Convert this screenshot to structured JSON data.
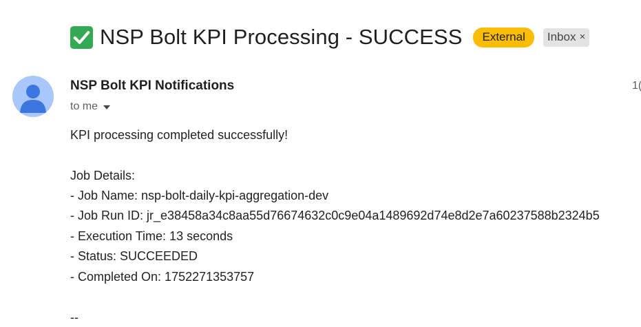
{
  "subject": {
    "icon": "check-mark-icon",
    "title": "NSP Bolt KPI Processing - SUCCESS",
    "labels": {
      "external": "External",
      "inbox": "Inbox",
      "remove_glyph": "×"
    }
  },
  "message": {
    "sender_name": "NSP Bolt KPI Notifications",
    "timestamp_partial": "1(",
    "recipient": "to me",
    "body": {
      "intro": "KPI processing completed successfully!",
      "details_heading": "Job Details:",
      "job_name": "- Job Name: nsp-bolt-daily-kpi-aggregation-dev",
      "job_run_id": "- Job Run ID: jr_e38458a34c8aa55d76674632c0c9e04a1489692d74e8d2e7a60237588b2324b5",
      "execution_time": "- Execution Time: 13 seconds",
      "status": "- Status: SUCCEEDED",
      "completed_on": "- Completed On: 1752271353757",
      "signature_sep": "--"
    }
  },
  "colors": {
    "external_badge": "#fbbc04",
    "inbox_badge": "#e3e3e3",
    "avatar_bg": "#a8c7fa",
    "avatar_fg": "#3b76e1",
    "check_green": "#34a853"
  }
}
